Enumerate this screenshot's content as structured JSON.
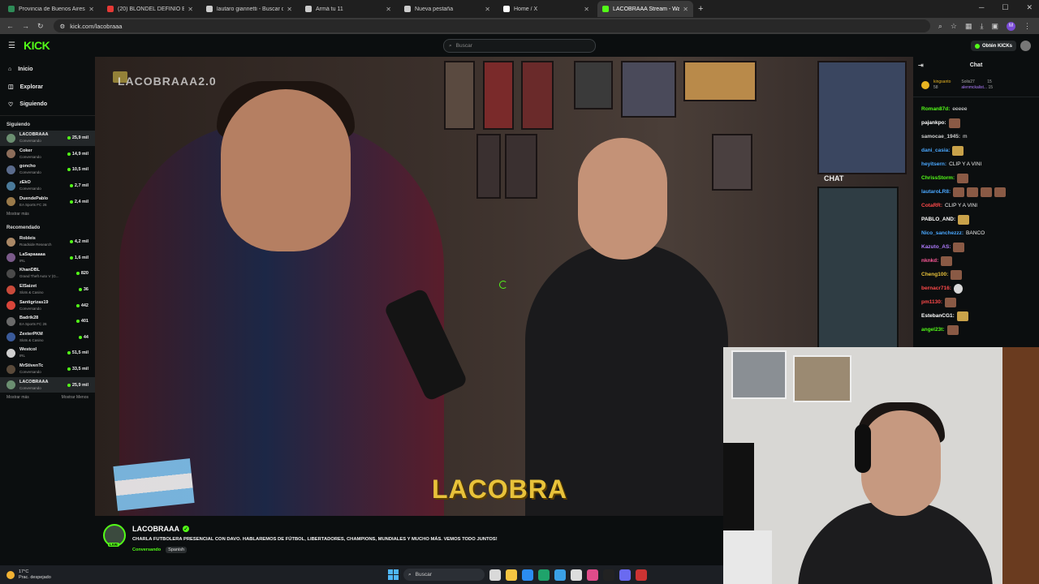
{
  "browser": {
    "tabs": [
      {
        "title": "Provincia de Buenos Aires |",
        "color": "#2e8b57",
        "active": false
      },
      {
        "title": "(20) BLONDEL DEFINIÓ BIEN. L",
        "color": "#e53935",
        "active": false
      },
      {
        "title": "lautaro giannetti - Buscar con G",
        "color": "#cccccc",
        "active": false
      },
      {
        "title": "Armá tu 11",
        "color": "#cccccc",
        "active": false
      },
      {
        "title": "Nueva pestaña",
        "color": "#cccccc",
        "active": false
      },
      {
        "title": "Home / X",
        "color": "#ffffff",
        "active": false
      },
      {
        "title": "LACOBRAAA Stream - Watch Li",
        "color": "#53fc18",
        "active": true
      }
    ],
    "new_tab": "+",
    "url": "kick.com/lacobraaa",
    "profile_initial": "M"
  },
  "header": {
    "logo": "KICK",
    "search_placeholder": "Buscar",
    "kicks_button": "Obtén KICKs"
  },
  "sidebar": {
    "nav": [
      {
        "label": "Inicio",
        "icon": "home-icon",
        "glyph": "⌂"
      },
      {
        "label": "Explorar",
        "icon": "compass-icon",
        "glyph": "◫"
      },
      {
        "label": "Siguiendo",
        "icon": "heart-icon",
        "glyph": "♡"
      }
    ],
    "following_title": "Siguiendo",
    "following": [
      {
        "name": "LACOBRAAA",
        "category": "Conversando",
        "viewers": "25,9 mil",
        "color": "#6b8f71",
        "selected": true
      },
      {
        "name": "Coker",
        "category": "Conversando",
        "viewers": "14,9 mil",
        "color": "#8c6d5a"
      },
      {
        "name": "goncho",
        "category": "Conversando",
        "viewers": "10,5 mil",
        "color": "#5a6b8c"
      },
      {
        "name": "zEkO",
        "category": "Conversando",
        "viewers": "2,7 mil",
        "color": "#4a7a9a"
      },
      {
        "name": "DuendePablo",
        "category": "EA Sports FC 26",
        "viewers": "2,4 mil",
        "color": "#9a7a4a"
      }
    ],
    "show_more_following": "Mostrar más",
    "recommended_title": "Recomendado",
    "recommended": [
      {
        "name": "Robleis",
        "category": "Roadside Research",
        "viewers": "4,2 mil",
        "color": "#aa8866"
      },
      {
        "name": "LaSapaaaaa",
        "category": "IRL",
        "viewers": "1,6 mil",
        "color": "#7a5a8a"
      },
      {
        "name": "KhanDBL",
        "category": "Grand Theft Auto V (G...",
        "viewers": "820",
        "color": "#4a4a4a"
      },
      {
        "name": "ElSaizet",
        "category": "Slots & Casino",
        "viewers": "36",
        "color": "#c94a3a"
      },
      {
        "name": "Santigrizas19",
        "category": "Conversando",
        "viewers": "442",
        "color": "#d9453a"
      },
      {
        "name": "Badrik28",
        "category": "EA Sports FC 26",
        "viewers": "401",
        "color": "#6a6a6a"
      },
      {
        "name": "ZexterPKM",
        "category": "Slots & Casino",
        "viewers": "44",
        "color": "#3a5a9a"
      },
      {
        "name": "Westcol",
        "category": "IRL",
        "viewers": "51,5 mil",
        "color": "#cfcfcf"
      },
      {
        "name": "MrStivenTc",
        "category": "Conversando",
        "viewers": "33,5 mil",
        "color": "#5a4a3a"
      },
      {
        "name": "LACOBRAAA",
        "category": "Conversando",
        "viewers": "25,9 mil",
        "color": "#6b8f71",
        "selected": true
      }
    ],
    "show_more": "Mostrar más",
    "show_less": "Mostrar Menos"
  },
  "video": {
    "watermark": "LACOBRAAA2.0",
    "overlay_text": "LACOBRA",
    "chat_screen_label": "CHAT"
  },
  "stream": {
    "channel": "LACOBRAAA",
    "live_badge": "LIVE",
    "title": "CHARLA FUTBOLERA PRESENCIAL CON DAVO. HABLAREMOS DE FÚTBOL, LIBERTADORES, CHAMPIONS, MUNDIALES Y MUCHO MÁS. VEMOS TODO JUNTOS!",
    "category": "Conversando",
    "tag": "Spanish"
  },
  "chat": {
    "title": "Chat",
    "pinned": {
      "user1": "kingsanto",
      "user1_count": "58",
      "user2": "Solis27",
      "user2_count": "15",
      "user3": "alenmckalist...",
      "user3_count": "15"
    },
    "messages": [
      {
        "user": "Roman87d:",
        "text": "eeeee",
        "color": "#53fc18"
      },
      {
        "user": "pajankpo:",
        "text": "",
        "color": "#ffffff",
        "emotes": 1
      },
      {
        "user": "samocae_1945:",
        "text": "m",
        "color": "#cfcfcf"
      },
      {
        "user": "dani_casia:",
        "text": "",
        "color": "#4aa8ff",
        "emotes": 1,
        "emote_style": "y"
      },
      {
        "user": "heyitsern:",
        "text": "CLIP Y A VINI",
        "color": "#4aa8ff"
      },
      {
        "user": "ChrissStorm:",
        "text": "",
        "color": "#53fc18",
        "emotes": 1
      },
      {
        "user": "lautaroLR8:",
        "text": "",
        "color": "#4aa8ff",
        "emotes": 4
      },
      {
        "user": "CotaRR:",
        "text": "CLIP Y A VINI",
        "color": "#ff4a4a"
      },
      {
        "user": "PABLO_AND:",
        "text": "",
        "color": "#ffffff",
        "emotes": 1,
        "emote_style": "y"
      },
      {
        "user": "Nico_sanchezzz:",
        "text": "BANCO",
        "color": "#4aa8ff"
      },
      {
        "user": "Kazuto_AS:",
        "text": "",
        "color": "#b07cff",
        "emotes": 1
      },
      {
        "user": "nknkd:",
        "text": "",
        "color": "#ff5a9a",
        "emotes": 1
      },
      {
        "user": "Cheng100:",
        "text": "",
        "color": "#e8c23a",
        "emotes": 1
      },
      {
        "user": "bernacr716:",
        "text": "",
        "color": "#ff4a4a",
        "emotes": 1,
        "emote_style": "b"
      },
      {
        "user": "pm1130:",
        "text": "",
        "color": "#ff4a4a",
        "emotes": 1
      },
      {
        "user": "EstebanCG1:",
        "text": "",
        "color": "#ffffff",
        "emotes": 1,
        "emote_style": "y"
      },
      {
        "user": "angel23t:",
        "text": "",
        "color": "#53fc18",
        "emotes": 1
      }
    ]
  },
  "taskbar": {
    "temperature": "17°C",
    "weather": "Prac. despejado",
    "search": "Buscar",
    "apps": [
      "#d9d9d9",
      "#f5c542",
      "#2b8cf2",
      "#1fa36b",
      "#3aa0e6",
      "#dddddd",
      "#e04c8a",
      "#222222",
      "#6a6af0",
      "#cc3333"
    ]
  }
}
